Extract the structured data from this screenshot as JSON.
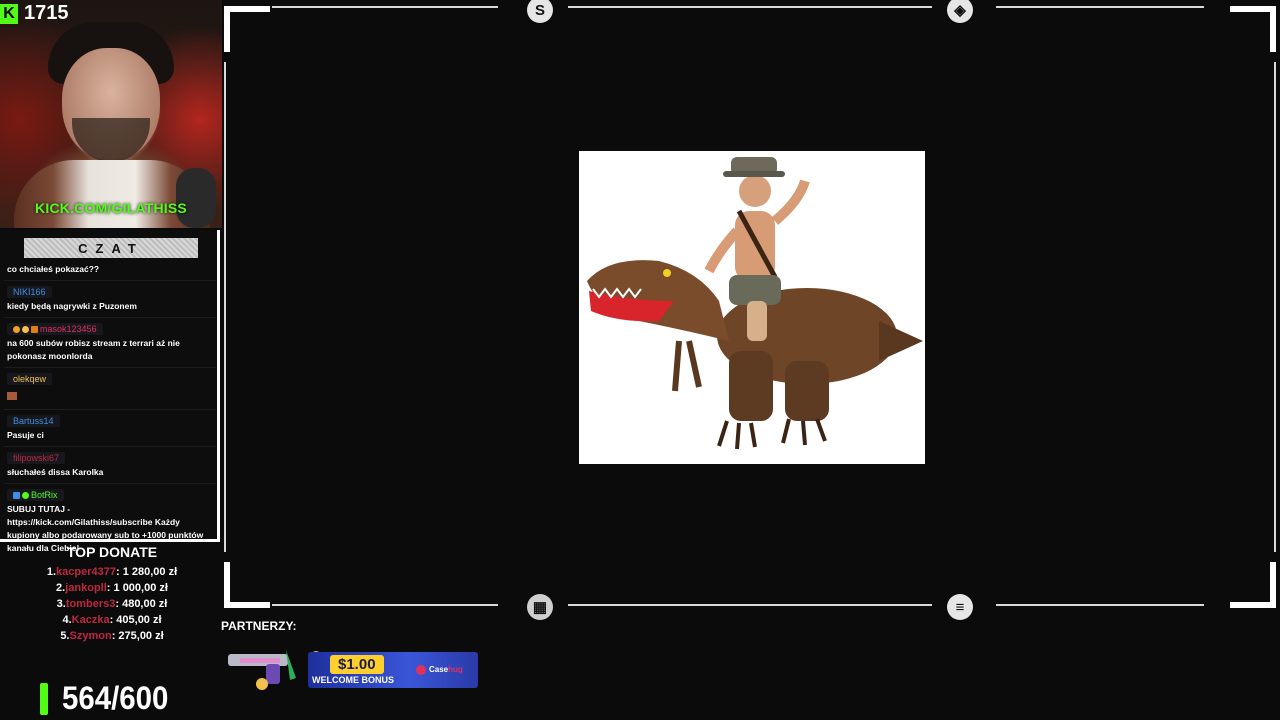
{
  "overlay": {
    "follower_count": "1715",
    "channel_url_prefix": "KICK.COM/",
    "channel_url_name": "GILATHISS"
  },
  "chat": {
    "header": "CZAT",
    "messages": [
      {
        "user": "",
        "text": "co chciałeś pokazać??",
        "user_color": ""
      },
      {
        "user": "NIKI166",
        "text": "kiedy będą nagrywki z Puzonem",
        "user_color": "blue"
      },
      {
        "user": "masok123456",
        "text": "na 600 subów robisz stream z terrari aż nie pokonasz moonlorda",
        "user_color": "red"
      },
      {
        "user": "olekqew",
        "text": "",
        "user_color": "yellow"
      },
      {
        "user": "Bartuss14",
        "text": "Pasuje ci",
        "user_color": "blue"
      },
      {
        "user": "filipowski67",
        "text": "słuchałeś dissa Karolka",
        "user_color": "dark"
      },
      {
        "user": "BotRix",
        "text": "SUBUJ TUTAJ - https://kick.com/Gilathiss/subscribe Każdy kupiony albo podarowany sub to +1000 punktów kanału dla Ciebie!",
        "user_color": "green"
      }
    ]
  },
  "top_donate": {
    "title": "TOP DONATE",
    "entries": [
      {
        "rank": "1.",
        "name": "kacper4377",
        "amount": ": 1 280,00 zł"
      },
      {
        "rank": "2.",
        "name": "jankopll",
        "amount": ": 1 000,00 zł"
      },
      {
        "rank": "3.",
        "name": "tombers3",
        "amount": ": 480,00 zł"
      },
      {
        "rank": "4.",
        "name": "Kaczka",
        "amount": ": 405,00 zł"
      },
      {
        "rank": "5.",
        "name": "Szymon",
        "amount": ": 275,00 zł"
      }
    ]
  },
  "sub_goal": {
    "text": "564/600",
    "current": 564,
    "target": 600
  },
  "partners": {
    "label": "PARTNERZY:",
    "banner_amount": "$1.00",
    "banner_sub": "WELCOME BONUS",
    "brand_a": "Case",
    "brand_b": "hug"
  },
  "colors": {
    "kick_green": "#53fc18",
    "donor_red": "#c0283f",
    "background": "#0b0b0c"
  }
}
